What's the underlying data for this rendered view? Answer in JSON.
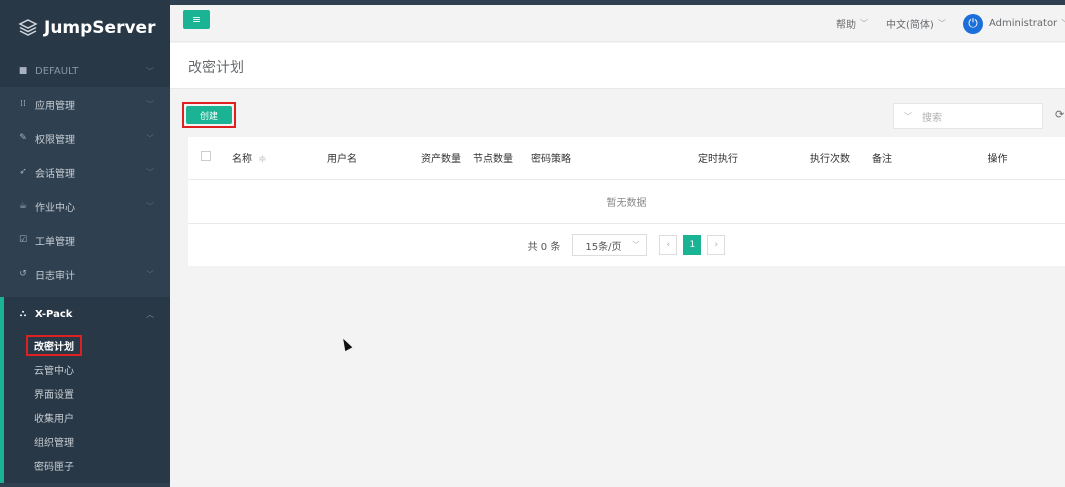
{
  "app": {
    "brand": "JumpServer"
  },
  "sidebar": {
    "org": "DEFAULT",
    "items": [
      {
        "label": "应用管理",
        "icon": "grid-icon"
      },
      {
        "label": "权限管理",
        "icon": "edit-icon"
      },
      {
        "label": "会话管理",
        "icon": "rocket-icon"
      },
      {
        "label": "作业中心",
        "icon": "coffee-icon"
      },
      {
        "label": "工单管理",
        "icon": "check-square-icon"
      },
      {
        "label": "日志审计",
        "icon": "history-icon"
      },
      {
        "label": "X-Pack",
        "icon": "sitemap-icon"
      }
    ],
    "xpack_items": [
      {
        "label": "改密计划"
      },
      {
        "label": "云管中心"
      },
      {
        "label": "界面设置"
      },
      {
        "label": "收集用户"
      },
      {
        "label": "组织管理"
      },
      {
        "label": "密码匣子"
      }
    ]
  },
  "topbar": {
    "help": "帮助",
    "language": "中文(简体)",
    "user": "Administrator"
  },
  "page": {
    "title": "改密计划"
  },
  "toolbar": {
    "create": "创建",
    "search_placeholder": "搜索"
  },
  "table": {
    "columns": [
      "名称",
      "用户名",
      "资产数量",
      "节点数量",
      "密码策略",
      "定时执行",
      "执行次数",
      "备注",
      "操作"
    ],
    "sort_indicator": "≑",
    "empty_text": "暂无数据"
  },
  "pagination": {
    "total": "共 0 条",
    "page_size": "15条/页",
    "current_page": "1"
  }
}
